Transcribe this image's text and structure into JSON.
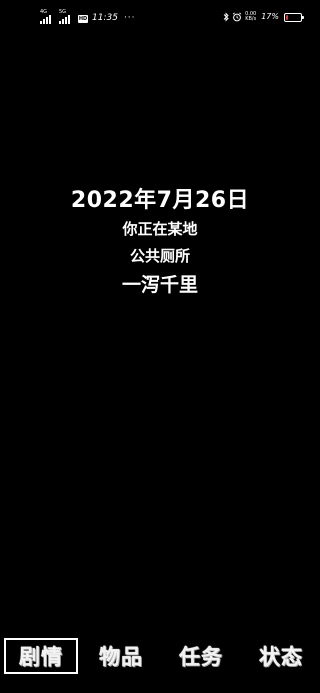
{
  "status_bar": {
    "signal_1_tag": "4G",
    "signal_2_tag": "5G",
    "hd_badge": "HD",
    "time": "11:35",
    "dots": "···",
    "net_speed_value": "0.00",
    "net_speed_unit": "KB/s",
    "battery_percent": "17%",
    "battery_level": 0.17,
    "battery_color": "#e03a3a",
    "icons": [
      "signal-icon",
      "signal-icon",
      "hd-icon",
      "bluetooth-icon",
      "alarm-icon",
      "battery-icon"
    ]
  },
  "story": {
    "date_year": "2022",
    "date_year_suffix": "年",
    "date_month": "7",
    "date_month_suffix": "月",
    "date_day": "26",
    "date_day_suffix": "日",
    "location_line": "你正在某地",
    "place_line": "公共厕所",
    "event_line": "一泻千里"
  },
  "menu": {
    "tabs": [
      {
        "label": "剧情",
        "active": true
      },
      {
        "label": "物品",
        "active": false
      },
      {
        "label": "任务",
        "active": false
      },
      {
        "label": "状态",
        "active": false
      }
    ]
  }
}
